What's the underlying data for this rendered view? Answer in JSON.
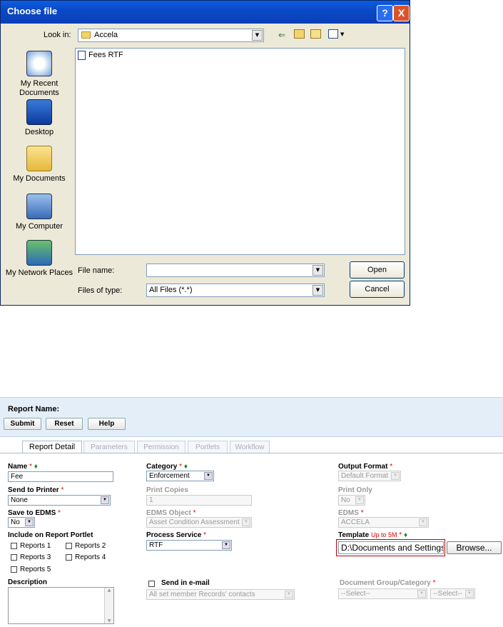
{
  "dialog": {
    "title": "Choose file",
    "help_label": "?",
    "close_label": "X",
    "look_in_label": "Look in:",
    "look_in_value": "Accela",
    "places": [
      {
        "label": "My Recent Documents",
        "icon": "recent-documents-icon"
      },
      {
        "label": "Desktop",
        "icon": "desktop-icon"
      },
      {
        "label": "My Documents",
        "icon": "my-documents-icon"
      },
      {
        "label": "My Computer",
        "icon": "my-computer-icon"
      },
      {
        "label": "My Network Places",
        "icon": "network-places-icon"
      }
    ],
    "files": [
      {
        "name": "Fees RTF",
        "icon": "word-document-icon"
      }
    ],
    "file_name_label": "File name:",
    "file_name_value": "",
    "file_type_label": "Files of type:",
    "file_type_value": "All Files (*.*)",
    "open_label": "Open",
    "cancel_label": "Cancel"
  },
  "report": {
    "header_label": "Report Name:",
    "buttons": {
      "submit": "Submit",
      "reset": "Reset",
      "help": "Help"
    },
    "tabs": [
      "Report Detail",
      "Parameters",
      "Permission",
      "Portlets",
      "Workflow"
    ],
    "fields": {
      "name_label": "Name",
      "name_value": "Fee",
      "category_label": "Category",
      "category_value": "Enforcement",
      "output_format_label": "Output Format",
      "output_format_value": "Default Format",
      "send_to_printer_label": "Send to Printer",
      "send_to_printer_value": "None",
      "print_copies_label": "Print Copies",
      "print_copies_value": "1",
      "print_only_label": "Print Only",
      "print_only_value": "No",
      "save_to_edms_label": "Save to EDMS",
      "save_to_edms_value": "No",
      "edms_object_label": "EDMS Object",
      "edms_object_value": "Asset Condition Assessment",
      "edms_label": "EDMS",
      "edms_value": "ACCELA",
      "include_portlet_label": "Include on Report Portlet",
      "reports": [
        "Reports 1",
        "Reports 2",
        "Reports 3",
        "Reports 4",
        "Reports 5"
      ],
      "process_service_label": "Process Service",
      "process_service_value": "RTF",
      "template_label": "Template",
      "template_limit": "Up to 5M",
      "template_value": "D:\\Documents and Settings",
      "browse_label": "Browse...",
      "description_label": "Description",
      "send_email_label": "Send in e-mail",
      "email_recipients_value": "All set member Records' contacts",
      "doc_group_label": "Document Group/Category",
      "doc_group_value": "--Select--",
      "doc_category_value": "--Select--"
    },
    "required_mark": "*",
    "diamond_mark": "♦"
  },
  "colors": {
    "title_bar": "#0a4fd0",
    "form_header": "#e4eef8",
    "required": "#d00000",
    "highlight_box": "#c00000"
  }
}
